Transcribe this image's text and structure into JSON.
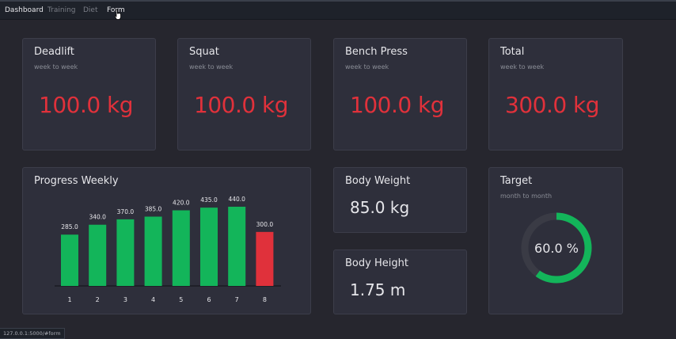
{
  "nav": {
    "items": [
      {
        "label": "Dashboard",
        "active": true
      },
      {
        "label": "Training",
        "active": false
      },
      {
        "label": "Diet",
        "active": false
      },
      {
        "label": "Form",
        "active": true
      }
    ]
  },
  "stats": [
    {
      "title": "Deadlift",
      "subtitle": "week to week",
      "value": "100.0 kg"
    },
    {
      "title": "Squat",
      "subtitle": "week to week",
      "value": "100.0 kg"
    },
    {
      "title": "Bench Press",
      "subtitle": "week to week",
      "value": "100.0 kg"
    },
    {
      "title": "Total",
      "subtitle": "week to week",
      "value": "300.0 kg"
    }
  ],
  "progress": {
    "title": "Progress Weekly"
  },
  "body_weight": {
    "title": "Body Weight",
    "value": "85.0 kg"
  },
  "body_height": {
    "title": "Body Height",
    "value": "1.75 m"
  },
  "target": {
    "title": "Target",
    "subtitle": "month to month",
    "label": "60.0 %",
    "percent": 60,
    "color_fill": "#13b55a",
    "color_track": "#3a3b45"
  },
  "status_url": "127.0.0.1:5000/#form",
  "colors": {
    "bar_green": "#13b55a",
    "bar_red": "#e0313b",
    "value_red": "#e0313b",
    "background": "#26262e",
    "card": "#2e2f3b"
  },
  "chart_data": {
    "type": "bar",
    "categories": [
      "1",
      "2",
      "3",
      "4",
      "5",
      "6",
      "7",
      "8"
    ],
    "values": [
      285.0,
      340.0,
      370.0,
      385.0,
      420.0,
      435.0,
      440.0,
      300.0
    ],
    "value_labels": [
      "285.0",
      "340.0",
      "370.0",
      "385.0",
      "420.0",
      "435.0",
      "440.0",
      "300.0"
    ],
    "bar_colors": [
      "#13b55a",
      "#13b55a",
      "#13b55a",
      "#13b55a",
      "#13b55a",
      "#13b55a",
      "#13b55a",
      "#e0313b"
    ],
    "title": "Progress Weekly",
    "ylim": [
      0,
      440
    ]
  }
}
